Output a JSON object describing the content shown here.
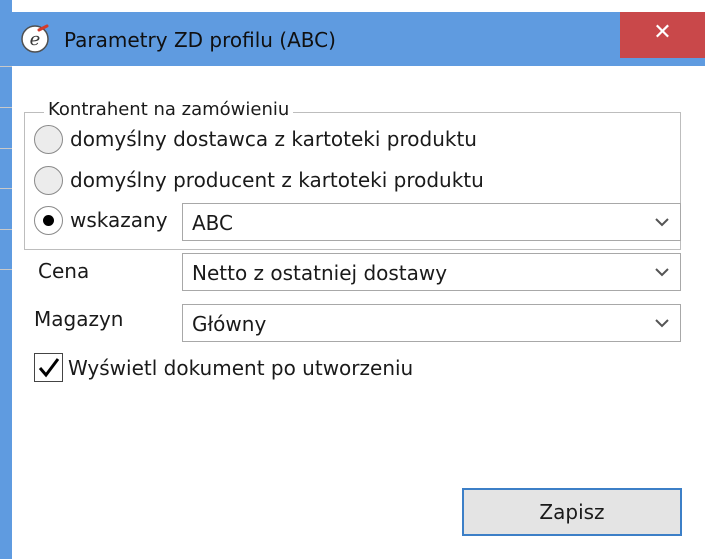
{
  "window": {
    "title": "Parametry ZD profilu (ABC)",
    "close_glyph": "✕",
    "icon": "app-logo-icon"
  },
  "contractor_group": {
    "title": "Kontrahent na zamówieniu",
    "options": [
      {
        "label": "domyślny dostawca z kartoteki produktu",
        "selected": false
      },
      {
        "label": "domyślny producent z kartoteki produktu",
        "selected": false
      },
      {
        "label": "wskazany",
        "selected": true
      }
    ],
    "specified_value": "ABC"
  },
  "price": {
    "label": "Cena",
    "value": "Netto z ostatniej dostawy"
  },
  "warehouse": {
    "label": "Magazyn",
    "value": "Główny"
  },
  "show_document": {
    "label": "Wyświetl dokument po utworzeniu",
    "checked": true
  },
  "save_button": {
    "label": "Zapisz"
  }
}
